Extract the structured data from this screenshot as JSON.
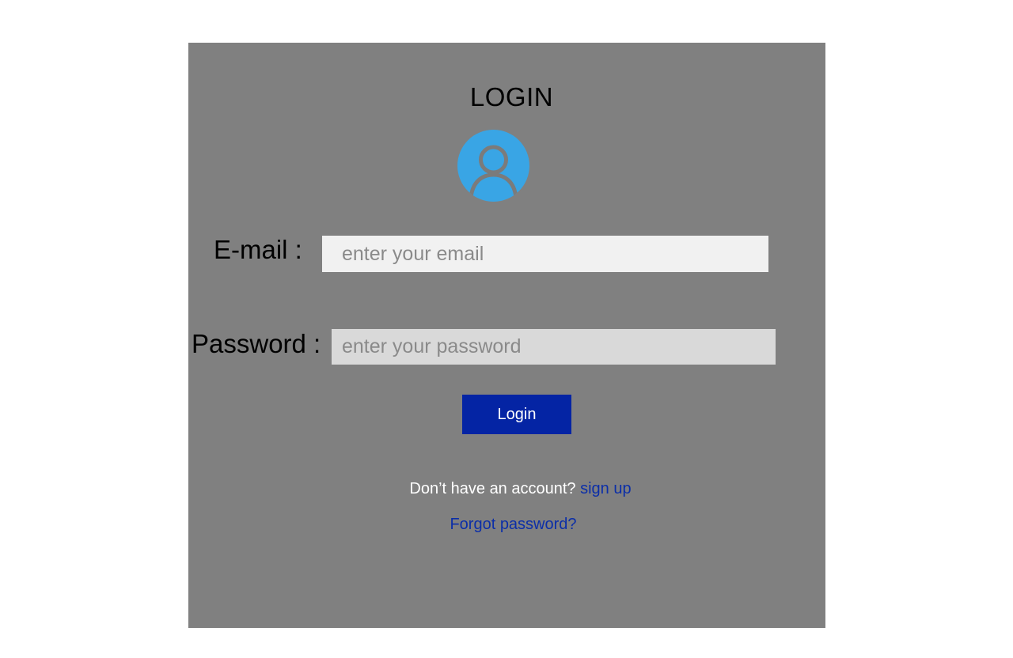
{
  "login_form": {
    "title": "LOGIN",
    "avatar_icon": "user-avatar-icon",
    "email": {
      "label": "E-mail :",
      "placeholder": "enter your email",
      "value": ""
    },
    "password": {
      "label": "Password :",
      "placeholder": "enter your password",
      "value": ""
    },
    "submit_label": "Login",
    "signup_prompt": "Don’t have an account?",
    "signup_link": "sign up",
    "forgot_link": "Forgot password?"
  },
  "colors": {
    "panel_background": "#808080",
    "avatar": "#39a5e5",
    "button": "#0424a4",
    "link": "#0b2ea8",
    "email_field": "#f1f1f1",
    "password_field": "#d9d9d9"
  }
}
